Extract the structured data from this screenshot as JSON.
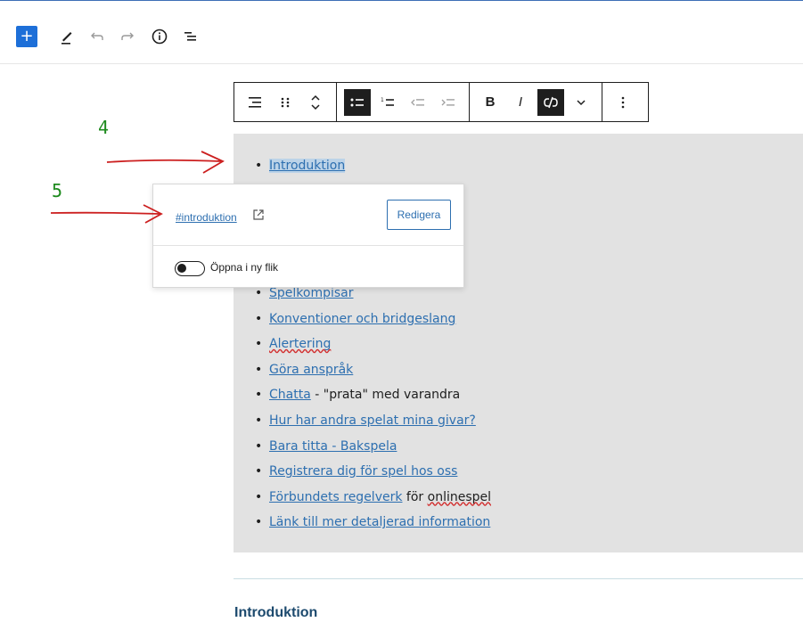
{
  "top_toolbar": {
    "add_label": "+"
  },
  "block_toolbar": {
    "bold_label": "B",
    "italic_label": "I"
  },
  "list_items": [
    {
      "link": "Introduktion",
      "suffix": ""
    },
    {
      "link": "Spelkompisar",
      "suffix": ""
    },
    {
      "link": "Konventioner och bridgeslang",
      "suffix": ""
    },
    {
      "link": "Alertering",
      "suffix": ""
    },
    {
      "link": "Göra anspråk",
      "suffix": ""
    },
    {
      "link": "Chatta",
      "suffix": " - \"prata\" med varandra"
    },
    {
      "link": "Hur har andra spelat mina givar?",
      "suffix": ""
    },
    {
      "link": "Bara titta - Bakspela",
      "suffix": ""
    },
    {
      "link": "Registrera dig för spel hos oss",
      "suffix": ""
    },
    {
      "link": "Förbundets regelverk",
      "suffix": " för ",
      "tail": "onlinespel"
    },
    {
      "link": "Länk till mer detaljerad information",
      "suffix": ""
    }
  ],
  "link_popover": {
    "url": "#introduktion",
    "edit_label": "Redigera",
    "new_tab_label": "Öppna i ny flik",
    "new_tab_enabled": false
  },
  "annotations": {
    "label_4": "4",
    "label_5": "5",
    "annotation_color": "#1d8a1d",
    "arrow_color": "#cc1f1f"
  },
  "section_heading": "Introduktion"
}
